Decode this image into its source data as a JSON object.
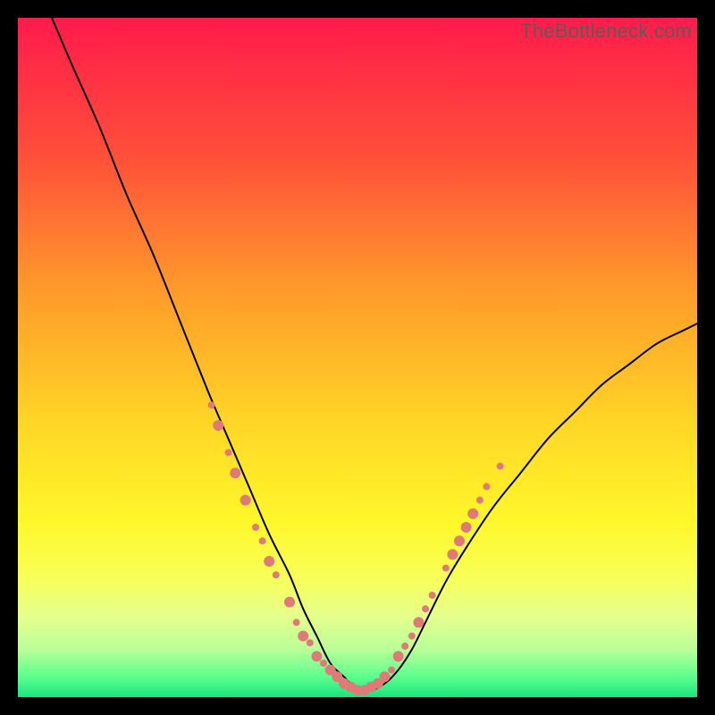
{
  "watermark": "TheBottleneck.com",
  "chart_data": {
    "type": "line",
    "title": "",
    "xlabel": "",
    "ylabel": "",
    "xlim": [
      0,
      100
    ],
    "ylim": [
      0,
      100
    ],
    "grid": false,
    "legend": false,
    "background_gradient": {
      "stops": [
        {
          "offset": 0.0,
          "color": "#ff1b4b"
        },
        {
          "offset": 0.2,
          "color": "#ff4e3a"
        },
        {
          "offset": 0.4,
          "color": "#ff9a2a"
        },
        {
          "offset": 0.6,
          "color": "#ffd726"
        },
        {
          "offset": 0.74,
          "color": "#fff72a"
        },
        {
          "offset": 0.82,
          "color": "#f8ff55"
        },
        {
          "offset": 0.88,
          "color": "#e6ff8c"
        },
        {
          "offset": 0.93,
          "color": "#b9ff98"
        },
        {
          "offset": 0.97,
          "color": "#5dff8e"
        },
        {
          "offset": 1.0,
          "color": "#18e57e"
        }
      ]
    },
    "series": [
      {
        "name": "curve",
        "stroke": "#000000",
        "stroke_width": 2,
        "x": [
          5,
          8,
          12,
          16,
          20,
          24,
          28,
          31,
          34,
          37,
          40,
          42,
          44,
          46,
          48,
          50,
          52,
          54,
          56,
          58,
          60,
          63,
          66,
          70,
          74,
          78,
          82,
          86,
          90,
          94,
          98,
          100
        ],
        "y": [
          100,
          93,
          84,
          74,
          65,
          55,
          45,
          38,
          31,
          24,
          18,
          13,
          9,
          5,
          3,
          1,
          1,
          2,
          4,
          7,
          11,
          17,
          22,
          28,
          33,
          38,
          42,
          46,
          49,
          52,
          54,
          55
        ]
      }
    ],
    "markers": {
      "color": "#e07a78",
      "radius_small": 4,
      "radius_large": 6,
      "points": [
        {
          "x": 28.5,
          "y": 43,
          "r": 4
        },
        {
          "x": 29.5,
          "y": 40,
          "r": 6
        },
        {
          "x": 31,
          "y": 36,
          "r": 4
        },
        {
          "x": 32,
          "y": 33,
          "r": 6
        },
        {
          "x": 33.5,
          "y": 29,
          "r": 6
        },
        {
          "x": 35,
          "y": 25,
          "r": 4
        },
        {
          "x": 36,
          "y": 23,
          "r": 4
        },
        {
          "x": 37,
          "y": 20,
          "r": 6
        },
        {
          "x": 38,
          "y": 18,
          "r": 4
        },
        {
          "x": 40,
          "y": 14,
          "r": 6
        },
        {
          "x": 41,
          "y": 11,
          "r": 4
        },
        {
          "x": 42,
          "y": 9,
          "r": 6
        },
        {
          "x": 43,
          "y": 8,
          "r": 4
        },
        {
          "x": 44,
          "y": 6,
          "r": 6
        },
        {
          "x": 45,
          "y": 5,
          "r": 4
        },
        {
          "x": 46,
          "y": 4,
          "r": 6
        },
        {
          "x": 47,
          "y": 3,
          "r": 6
        },
        {
          "x": 48,
          "y": 2,
          "r": 6
        },
        {
          "x": 49,
          "y": 1.5,
          "r": 6
        },
        {
          "x": 50,
          "y": 1,
          "r": 6
        },
        {
          "x": 51,
          "y": 1,
          "r": 6
        },
        {
          "x": 52,
          "y": 1.5,
          "r": 6
        },
        {
          "x": 53,
          "y": 2,
          "r": 6
        },
        {
          "x": 54,
          "y": 3,
          "r": 6
        },
        {
          "x": 55,
          "y": 4,
          "r": 4
        },
        {
          "x": 56,
          "y": 6,
          "r": 6
        },
        {
          "x": 57,
          "y": 7.5,
          "r": 4
        },
        {
          "x": 58,
          "y": 9,
          "r": 4
        },
        {
          "x": 59,
          "y": 11,
          "r": 6
        },
        {
          "x": 60,
          "y": 13,
          "r": 4
        },
        {
          "x": 61,
          "y": 15,
          "r": 4
        },
        {
          "x": 63,
          "y": 19,
          "r": 4
        },
        {
          "x": 64,
          "y": 21,
          "r": 6
        },
        {
          "x": 65,
          "y": 23,
          "r": 6
        },
        {
          "x": 66,
          "y": 25,
          "r": 6
        },
        {
          "x": 67,
          "y": 27,
          "r": 6
        },
        {
          "x": 68,
          "y": 29,
          "r": 4
        },
        {
          "x": 69,
          "y": 31,
          "r": 4
        },
        {
          "x": 71,
          "y": 34,
          "r": 4
        }
      ]
    }
  }
}
